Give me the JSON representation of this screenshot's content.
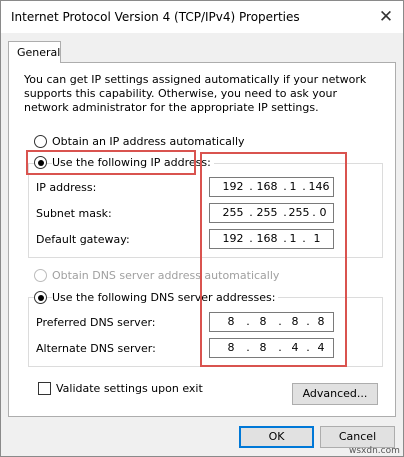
{
  "window": {
    "title": "Internet Protocol Version 4 (TCP/IPv4) Properties",
    "close_glyph": "✕"
  },
  "tabs": [
    {
      "label": "General"
    }
  ],
  "intro_text": "You can get IP settings assigned automatically if your network supports this capability. Otherwise, you need to ask your network administrator for the appropriate IP settings.",
  "ip_mode": {
    "auto_label": "Obtain an IP address automatically",
    "manual_label": "Use the following IP address:",
    "selected": "manual"
  },
  "ip_fields": [
    {
      "label": "IP address:",
      "octets": [
        "192",
        "168",
        "1",
        "146"
      ]
    },
    {
      "label": "Subnet mask:",
      "octets": [
        "255",
        "255",
        "255",
        "0"
      ]
    },
    {
      "label": "Default gateway:",
      "octets": [
        "192",
        "168",
        "1",
        "1"
      ]
    }
  ],
  "dns_mode": {
    "auto_label": "Obtain DNS server address automatically",
    "manual_label": "Use the following DNS server addresses:",
    "selected": "manual"
  },
  "dns_fields": [
    {
      "label": "Preferred DNS server:",
      "octets": [
        "8",
        "8",
        "8",
        "8"
      ]
    },
    {
      "label": "Alternate DNS server:",
      "octets": [
        "8",
        "8",
        "4",
        "4"
      ]
    }
  ],
  "validate": {
    "label": "Validate settings upon exit",
    "checked": false
  },
  "buttons": {
    "advanced": "Advanced...",
    "ok": "OK",
    "cancel": "Cancel"
  },
  "watermark": "wsxdn.com",
  "colors": {
    "highlight": "#d9534f",
    "focus": "#0078d7"
  }
}
